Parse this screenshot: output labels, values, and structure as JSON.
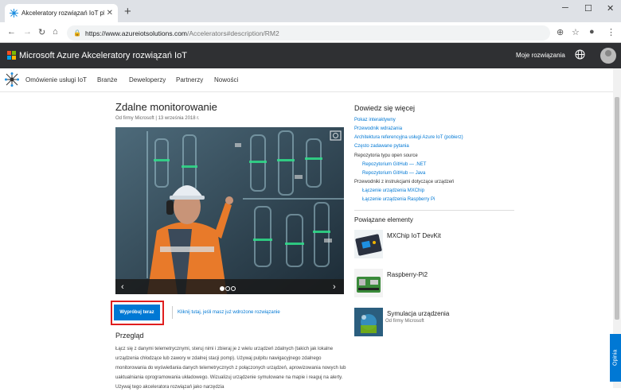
{
  "browser": {
    "tab_title": "Akceleratory rozwiązań IoT platf",
    "tab_close": "✕",
    "new_tab": "+",
    "url_host": "https://www.azureiotsolutions.com",
    "url_path": "/Accelerators#description/RM2",
    "win_minimize": "─",
    "win_maximize": "☐",
    "win_close": "✕"
  },
  "header": {
    "title": "Microsoft Azure Akceleratory rozwiązań IoT",
    "my_solutions": "Moje rozwiązania"
  },
  "subnav": {
    "items": [
      "Omówienie usługi IoT",
      "Branże",
      "Deweloperzy",
      "Partnerzy",
      "Nowości"
    ]
  },
  "main": {
    "title": "Zdalne monitorowanie",
    "byline": "Od firmy Microsoft | 13 września 2018 r.",
    "try_button": "Wypróbuj teraz",
    "deployed_link": "Kliknij tutaj, jeśli masz już wdrożone rozwiązanie",
    "overview_heading": "Przegląd",
    "description": "Łącz się z danymi telemetrycznymi, steruj nimi i zbieraj je z wielu urządzeń zdalnych (takich jak lokalne urządzenia chłodzące lub zawory w zdalnej stacji pomp). Używaj pulpitu nawigacyjnego zdalnego monitorowania do wyświetlania danych telemetrycznych z połączonych urządzeń, aprowizowania nowych lub uaktualniania oprogramowania układowego. Wizualizuj urządzenie symulowane na mapie i reaguj na alerty. Używaj tego akceleratora rozwiązań jako narzędzia"
  },
  "sidebar": {
    "learn_heading": "Dowiedz się więcej",
    "links": [
      "Pokaz interaktywny",
      "Przewodnik wdrażania",
      "Architektura referencyjna usługi Azure IoT (pobierz)",
      "Często zadawane pytania"
    ],
    "repo_label": "Repozytoria typu open source",
    "repo_links": [
      "Repozytorium GitHub — .NET",
      "Repozytorium GitHub — Java"
    ],
    "guides_label": "Przewodniki z instrukcjami dotyczące urządzeń",
    "guide_links": [
      "Łączenie urządzenia MXChip",
      "Łączenie urządzenia Raspberry Pi"
    ],
    "related_heading": "Powiązane elementy",
    "related": [
      {
        "name": "MXChip IoT DevKit",
        "sub": ""
      },
      {
        "name": "Raspberry-Pi2",
        "sub": ""
      },
      {
        "name": "Symulacja urządzenia",
        "sub": "Od firmy Microsoft"
      }
    ]
  },
  "feedback": "Opinia",
  "colors": {
    "accent": "#0078d4",
    "header_bg": "#2f3033",
    "highlight": "#e01e1e"
  }
}
